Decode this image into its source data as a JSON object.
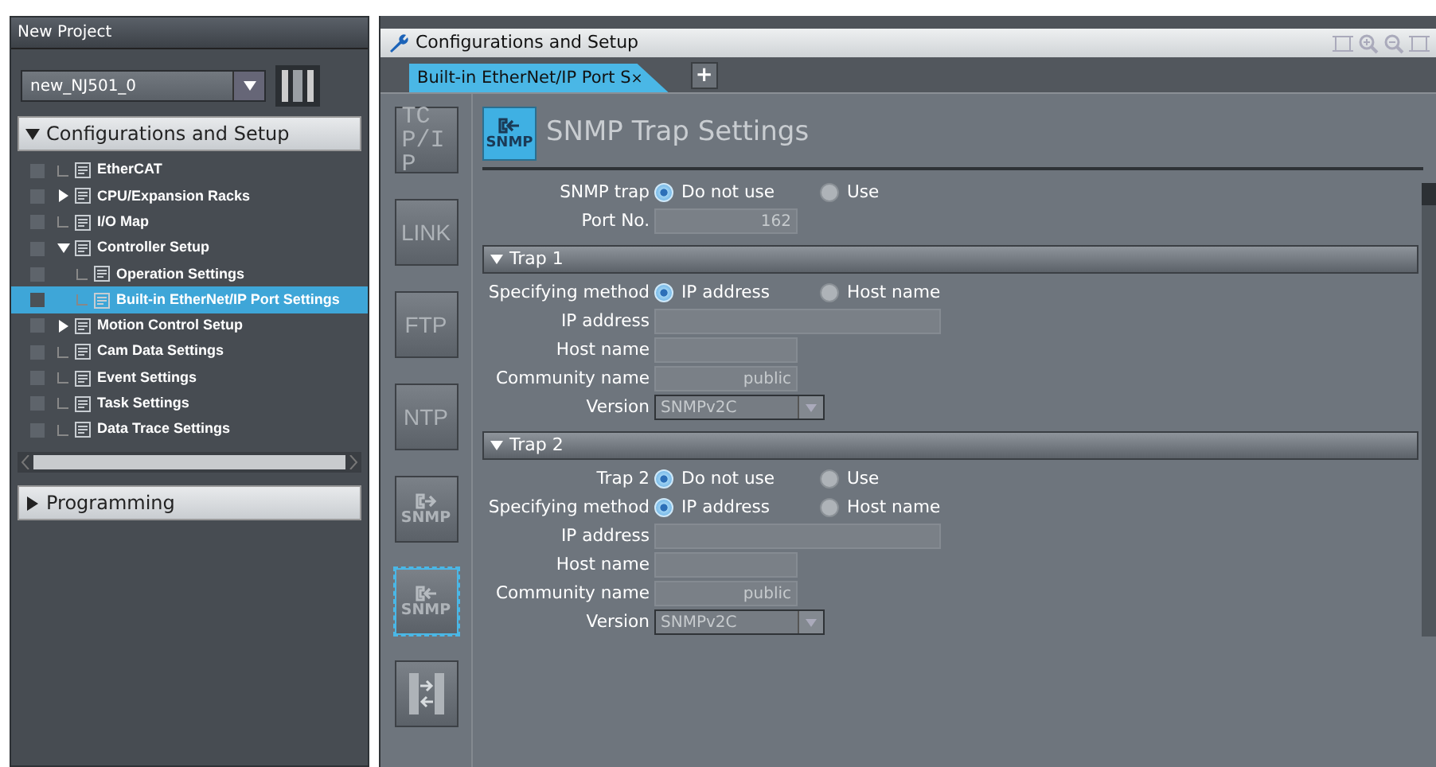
{
  "sidebar": {
    "title": "New Project",
    "device": "new_NJ501_0",
    "sections": [
      {
        "label": "Configurations and Setup",
        "expanded": true,
        "items": [
          {
            "label": "EtherCAT",
            "checked": false,
            "selected": false
          },
          {
            "label": "CPU/Expansion Racks",
            "checked": false,
            "selected": false,
            "expanded": false
          },
          {
            "label": "I/O Map",
            "checked": false,
            "selected": false
          },
          {
            "label": "Controller Setup",
            "checked": false,
            "selected": false,
            "expanded": true,
            "children": [
              {
                "label": "Operation Settings",
                "checked": false,
                "selected": false
              },
              {
                "label": "Built-in EtherNet/IP Port Settings",
                "checked": false,
                "selected": true
              }
            ]
          },
          {
            "label": "Motion Control Setup",
            "checked": false,
            "selected": false,
            "expanded": false
          },
          {
            "label": "Cam Data Settings",
            "checked": false,
            "selected": false
          },
          {
            "label": "Event Settings",
            "checked": false,
            "selected": false
          },
          {
            "label": "Task Settings",
            "checked": false,
            "selected": false
          },
          {
            "label": "Data Trace Settings",
            "checked": false,
            "selected": false
          }
        ]
      },
      {
        "label": "Programming",
        "expanded": false
      }
    ]
  },
  "editor": {
    "title": "Configurations and Setup",
    "tabs": [
      {
        "label": "Built-in EtherNet/IP Port S",
        "close": "×",
        "selected": true
      }
    ],
    "add_tab": "+",
    "side_buttons": [
      {
        "kind": "stacked-text",
        "label": "TCP/IP",
        "selected": false
      },
      {
        "kind": "text",
        "label": "LINK",
        "selected": false
      },
      {
        "kind": "text",
        "label": "FTP",
        "selected": false
      },
      {
        "kind": "text",
        "label": "NTP",
        "selected": false
      },
      {
        "kind": "snmp-send",
        "label": "SNMP",
        "selected": false
      },
      {
        "kind": "snmp-trap",
        "label": "SNMP",
        "selected": true
      },
      {
        "kind": "transfer",
        "selected": false
      }
    ],
    "heading": {
      "icon_label": "SNMP",
      "title": "SNMP Trap Settings"
    },
    "rows": [
      {
        "kind": "radio",
        "label": "SNMP trap",
        "options": [
          {
            "label": "Do not use",
            "selected": true
          },
          {
            "label": "Use",
            "selected": false
          }
        ]
      },
      {
        "kind": "field",
        "label": "Port No.",
        "value": "162",
        "disabled": true
      }
    ],
    "groups": [
      {
        "title": "Trap 1",
        "expanded": true,
        "rows": [
          {
            "kind": "radio",
            "label": "Specifying method",
            "options": [
              {
                "label": "IP address",
                "selected": true
              },
              {
                "label": "Host name",
                "selected": false
              }
            ]
          },
          {
            "kind": "address",
            "label": "IP address",
            "value": "",
            "disabled": true
          },
          {
            "kind": "field",
            "label": "Host name",
            "value": "",
            "disabled": true
          },
          {
            "kind": "field",
            "label": "Community name",
            "value": "public",
            "disabled": true
          },
          {
            "kind": "select",
            "label": "Version",
            "value": "SNMPv2C",
            "disabled": true
          }
        ]
      },
      {
        "title": "Trap 2",
        "expanded": true,
        "rows": [
          {
            "kind": "radio",
            "label": "Trap 2",
            "options": [
              {
                "label": "Do not use",
                "selected": true
              },
              {
                "label": "Use",
                "selected": false
              }
            ]
          },
          {
            "kind": "radio",
            "label": "Specifying method",
            "options": [
              {
                "label": "IP address",
                "selected": true
              },
              {
                "label": "Host name",
                "selected": false
              }
            ]
          },
          {
            "kind": "address",
            "label": "IP address",
            "value": "",
            "disabled": true
          },
          {
            "kind": "field",
            "label": "Host name",
            "value": "",
            "disabled": true
          },
          {
            "kind": "field",
            "label": "Community name",
            "value": "public",
            "disabled": true
          },
          {
            "kind": "select",
            "label": "Version",
            "value": "SNMPv2C",
            "disabled": true
          }
        ]
      }
    ]
  }
}
